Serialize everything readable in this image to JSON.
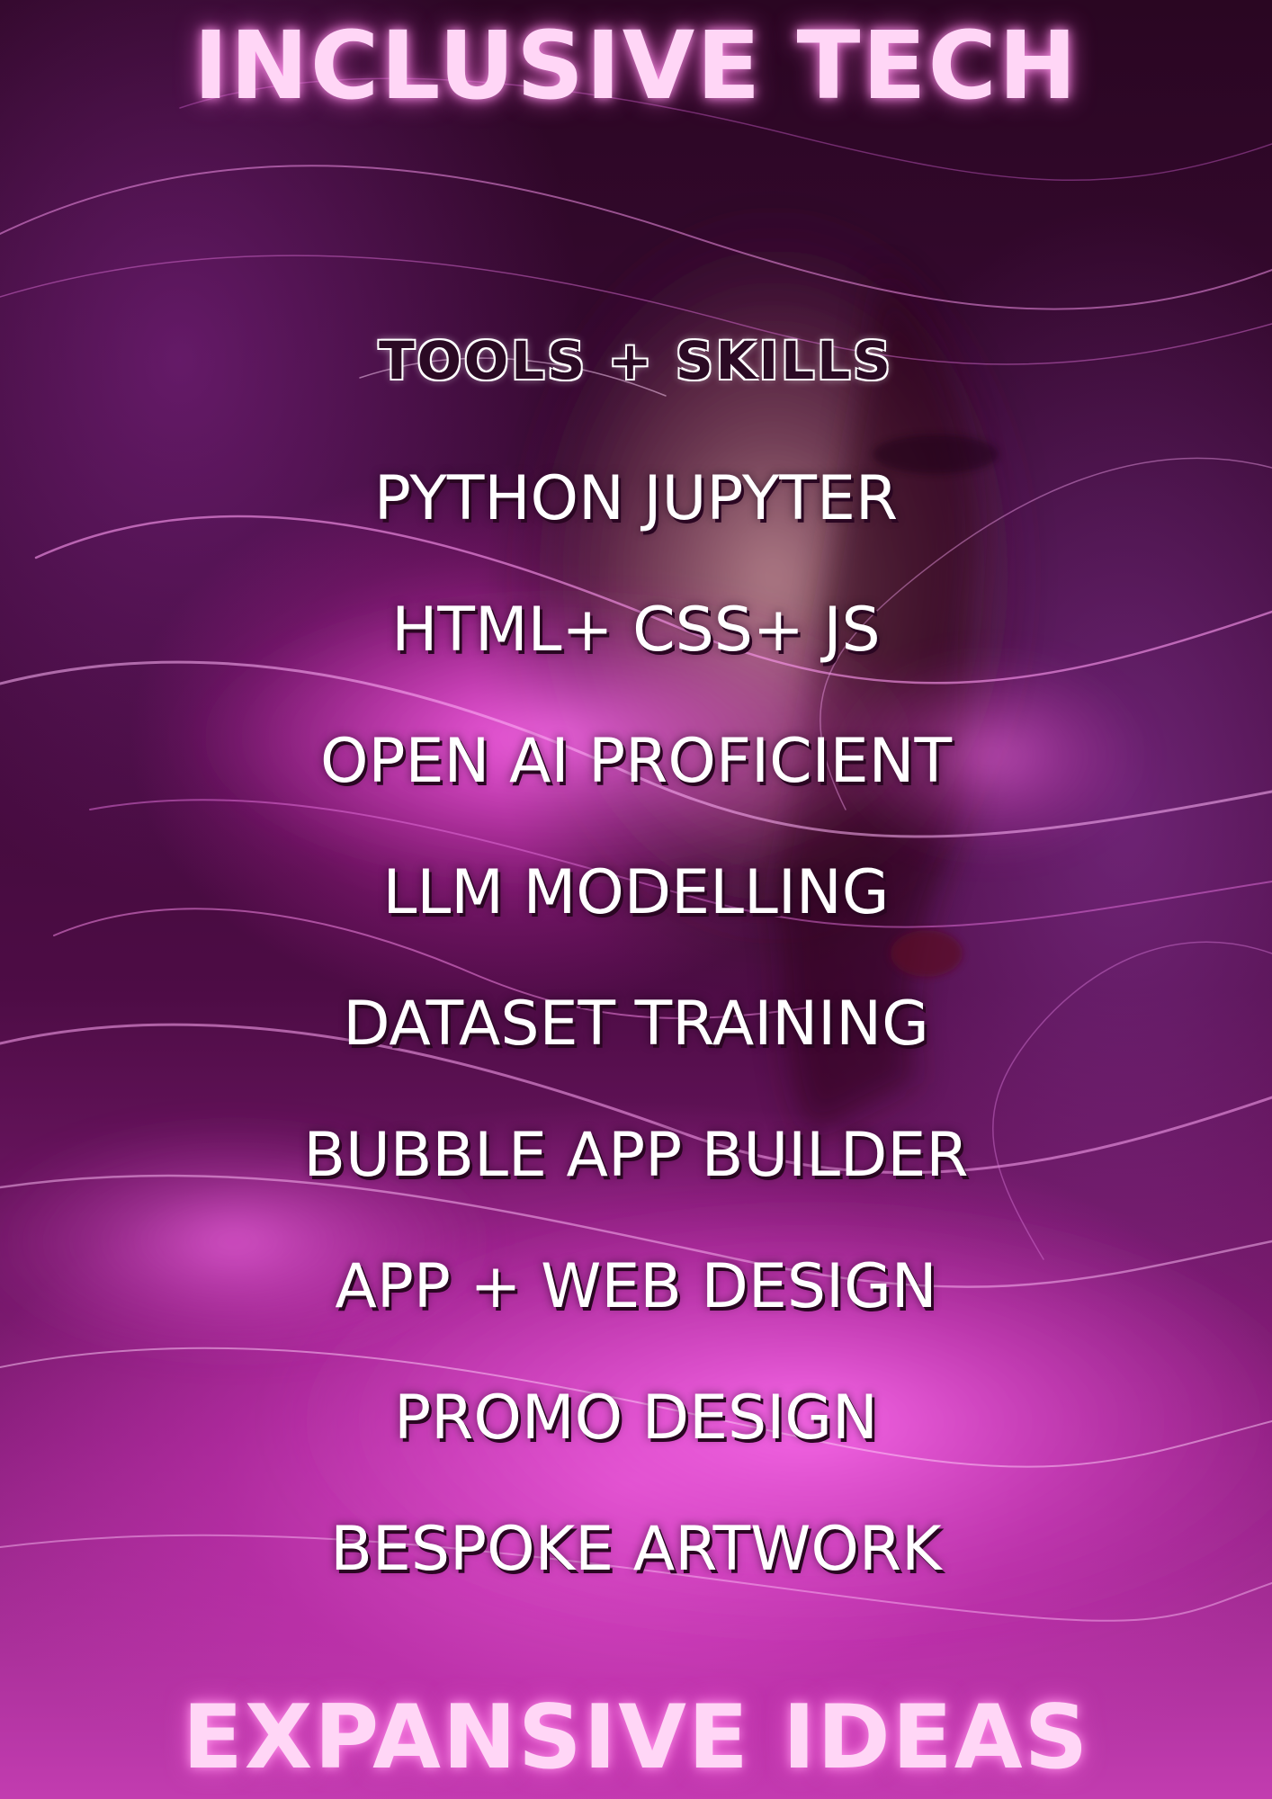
{
  "poster": {
    "title_top": "INCLUSIVE TECH",
    "title_bottom": "EXPANSIVE IDEAS",
    "section_heading": "TOOLS + SKILLS",
    "skills": [
      "PYTHON JUPYTER",
      "HTML+ CSS+ JS",
      "OPEN  AI PROFICIENT",
      "LLM  MODELLING",
      "DATASET TRAINING",
      "BUBBLE APP BUILDER",
      "APP + WEB DESIGN",
      "PROMO DESIGN",
      "BESPOKE ARTWORK"
    ],
    "colors": {
      "headline": "#ffd6f6",
      "skill_text": "#ffffff",
      "section_heading": "#2b0a24",
      "accent_magenta": "#e040c8",
      "background_dark": "#2a0622"
    },
    "background_image": "portrait-with-magenta-light-trails"
  }
}
